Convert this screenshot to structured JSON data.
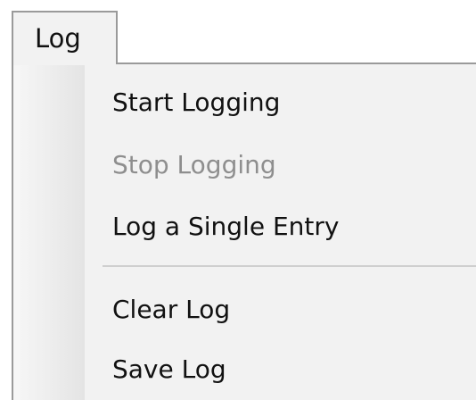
{
  "menu": {
    "title": "Log",
    "items": [
      {
        "label": "Start Logging",
        "enabled": true
      },
      {
        "label": "Stop Logging",
        "enabled": false
      },
      {
        "label": "Log a Single Entry",
        "enabled": true
      },
      {
        "label": "Clear Log",
        "enabled": true
      },
      {
        "label": "Save Log",
        "enabled": true
      }
    ]
  },
  "colors": {
    "text": "#111111",
    "disabled_text": "#8e8e8e",
    "menu_background": "#f2f2f2",
    "border": "#9a9a9a",
    "separator": "#cfcfcf"
  }
}
